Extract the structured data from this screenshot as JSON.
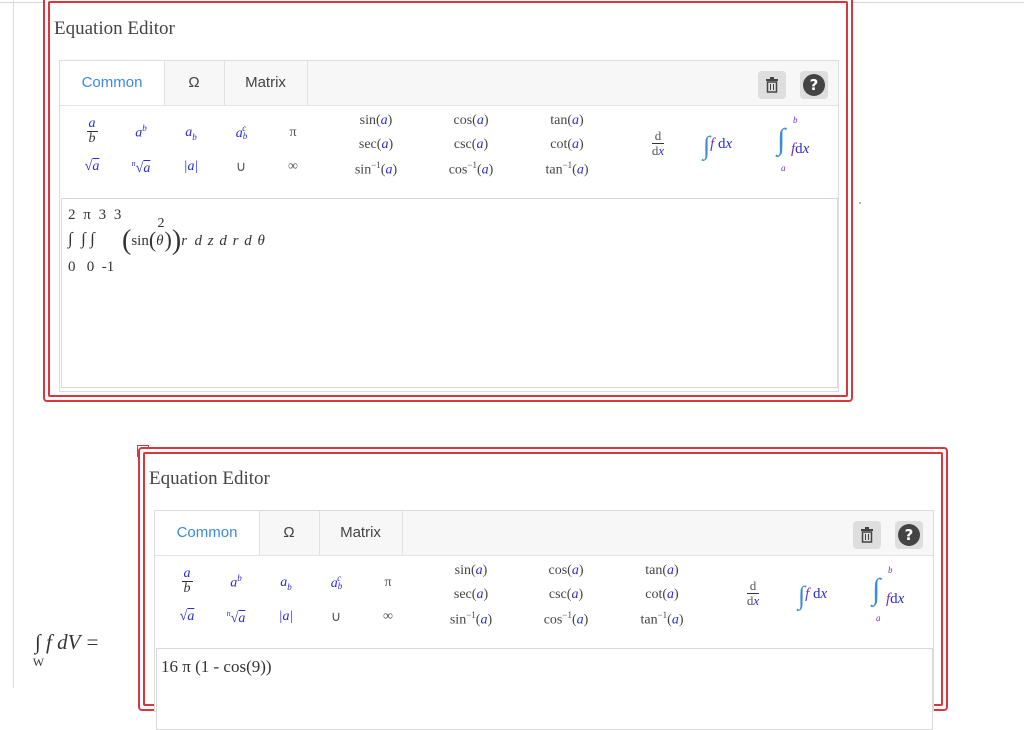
{
  "editor1": {
    "title": "Equation Editor",
    "tabs": [
      "Common",
      "Ω",
      "Matrix"
    ],
    "input_expression": {
      "upper_limits": "2 π  3  3",
      "integrand_fn": "sin",
      "integrand_arg": "θ",
      "exponent": "2",
      "factor": "r",
      "differentials": "d z d r  d θ",
      "lower_limits": "0   0  -1"
    }
  },
  "editor2": {
    "title": "Equation Editor",
    "tabs": [
      "Common",
      "Ω",
      "Matrix"
    ],
    "input_expression": "16 π (1 - cos(9))"
  },
  "palette": {
    "row1": [
      "a/b",
      "a^b",
      "a_b",
      "a_b^c",
      "π"
    ],
    "row2": [
      "√a",
      "ⁿ√a",
      "|a|",
      "∪",
      "∞"
    ],
    "trig_col1": [
      "sin(a)",
      "sec(a)",
      "sin⁻¹(a)"
    ],
    "trig_col2": [
      "cos(a)",
      "csc(a)",
      "cos⁻¹(a)"
    ],
    "trig_col3": [
      "tan(a)",
      "cot(a)",
      "tan⁻¹(a)"
    ],
    "derivative": {
      "num": "d",
      "den": "d x"
    },
    "integral": "∫ f d x",
    "definite_integral": {
      "upper": "b",
      "lower": "a",
      "body": "∫ f d x"
    }
  },
  "lhs_expression": "∫ f dV =",
  "lhs_subscript": "W",
  "icons": [
    "trash-icon",
    "help-icon",
    "close-icon"
  ],
  "colors": {
    "frame": "#d9363e",
    "active_tab": "#3a8bd8",
    "variable": "#2b2bd6"
  }
}
